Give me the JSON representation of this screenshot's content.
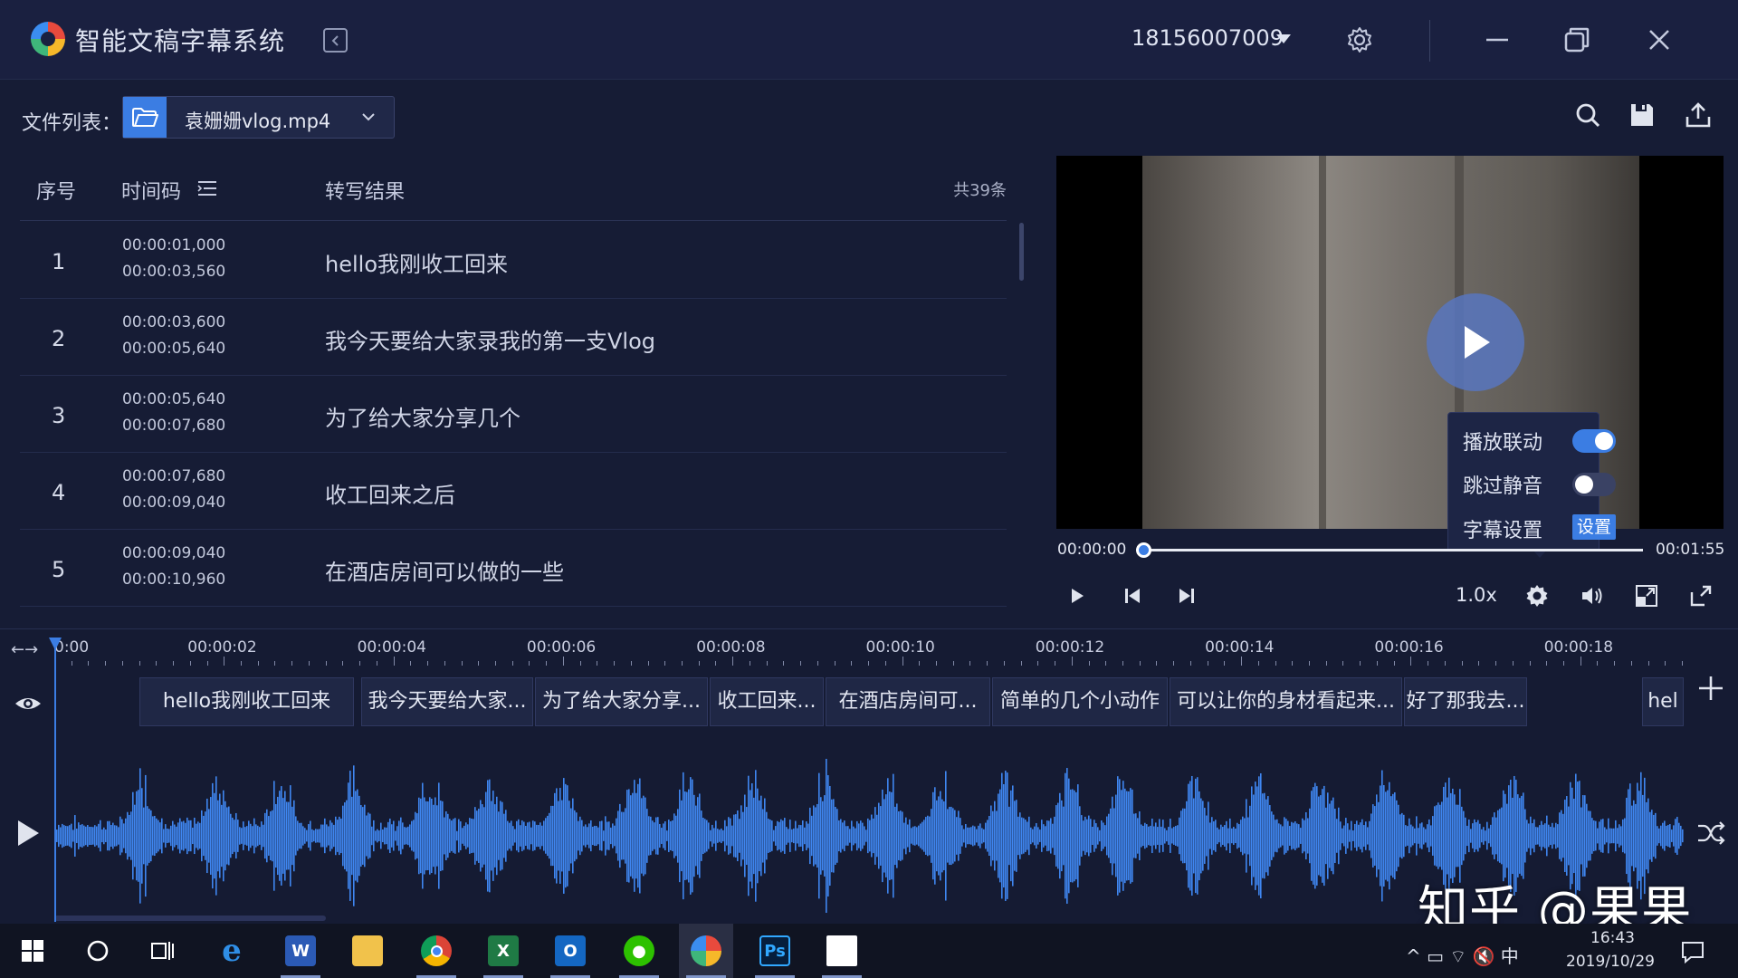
{
  "app": {
    "title": "智能文稿字幕系统",
    "account": "18156007009"
  },
  "file": {
    "label": "文件列表：",
    "name": "袁姗姗vlog.mp4"
  },
  "table": {
    "headers": {
      "index": "序号",
      "time": "时间码",
      "result": "转写结果"
    },
    "count": "共39条",
    "rows": [
      {
        "index": "1",
        "start": "00:00:01,000",
        "end": "00:00:03,560",
        "text": "hello我刚收工回来"
      },
      {
        "index": "2",
        "start": "00:00:03,600",
        "end": "00:00:05,640",
        "text": "我今天要给大家录我的第一支Vlog"
      },
      {
        "index": "3",
        "start": "00:00:05,640",
        "end": "00:00:07,680",
        "text": "为了给大家分享几个"
      },
      {
        "index": "4",
        "start": "00:00:07,680",
        "end": "00:00:09,040",
        "text": "收工回来之后"
      },
      {
        "index": "5",
        "start": "00:00:09,040",
        "end": "00:00:10,960",
        "text": "在酒店房间可以做的一些"
      }
    ]
  },
  "player": {
    "current_time": "00:00:00",
    "total_time": "00:01:55",
    "speed": "1.0x",
    "progress": 0.0,
    "settings_popup": {
      "sync_label": "播放联动",
      "sync_on": true,
      "silence_label": "跳过静音",
      "silence_on": false,
      "subtitle_label": "字幕设置",
      "subtitle_button": "设置"
    }
  },
  "timeline": {
    "zoom_label": "←→",
    "ticks": [
      "0:00",
      "00:00:02",
      "00:00:04",
      "00:00:06",
      "00:00:08",
      "00:00:10",
      "00:00:12",
      "00:00:14",
      "00:00:16",
      "00:00:18"
    ],
    "subtitle_chips": [
      "hello我刚收工回来",
      "我今天要给大家...",
      "为了给大家分享...",
      "收工回来...",
      "在酒店房间可...",
      "简单的几个小动作",
      "可以让你的身材看起来...",
      "好了那我去...",
      "hel"
    ]
  },
  "watermark": "知乎 @果果",
  "taskbar": {
    "apps": [
      "windows-start",
      "search",
      "task-view",
      "edge",
      "word",
      "file-explorer",
      "chrome",
      "excel",
      "outlook",
      "wechat",
      "subtitle-app",
      "photoshop",
      "video-editor"
    ],
    "tray": "^ ▭ ⌔ 🔇 中",
    "time": "16:43",
    "date": "2019/10/29"
  },
  "colors": {
    "accent": "#3b7de3",
    "background": "#161c35",
    "waveform": "#3f86f0"
  }
}
